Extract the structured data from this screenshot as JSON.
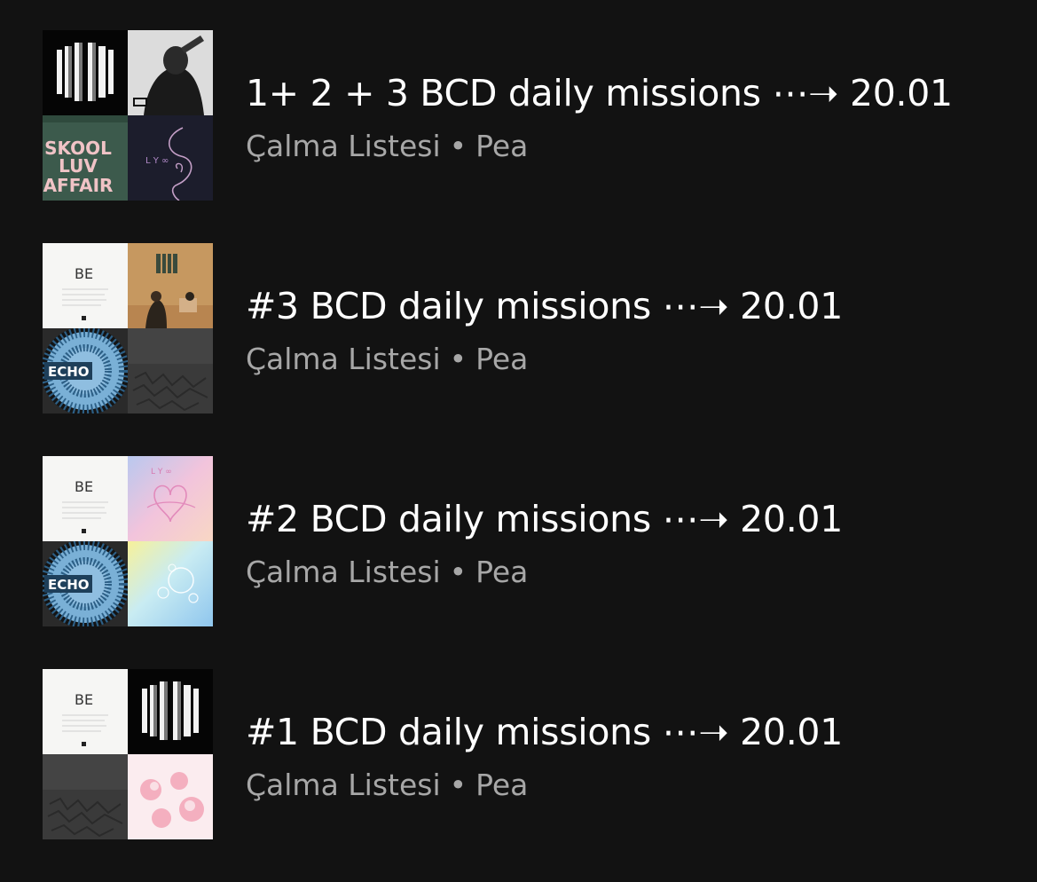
{
  "playlists": [
    {
      "title": "1+ 2 + 3 BCD daily missions ⋯➝ 20.01",
      "type": "Çalma Listesi",
      "owner": "Pea",
      "covers": [
        "proof-logo-art",
        "dark-portrait-art",
        "skool-luv-affair-art",
        "lys-her-dark-art"
      ]
    },
    {
      "title": "#3 BCD daily missions ⋯➝ 20.01",
      "type": "Çalma Listesi",
      "owner": "Pea",
      "covers": [
        "be-album-art",
        "room-photo-art",
        "echo-disc-art",
        "grey-texture-art"
      ]
    },
    {
      "title": "#2 BCD daily missions ⋯➝ 20.01",
      "type": "Çalma Listesi",
      "owner": "Pea",
      "covers": [
        "be-album-art",
        "lys-pastel-art",
        "echo-disc-art",
        "bubble-art"
      ]
    },
    {
      "title": "#1 BCD daily missions ⋯➝ 20.01",
      "type": "Çalma Listesi",
      "owner": "Pea",
      "covers": [
        "be-album-art",
        "proof-logo-art",
        "grey-texture-art",
        "hyyh-pink-art"
      ]
    }
  ],
  "tile_text": {
    "skool": [
      "SKOOL",
      "LUV",
      "AFFAIR"
    ],
    "be": "BE",
    "echo": "ECHO",
    "lys": "L Y ∞"
  }
}
